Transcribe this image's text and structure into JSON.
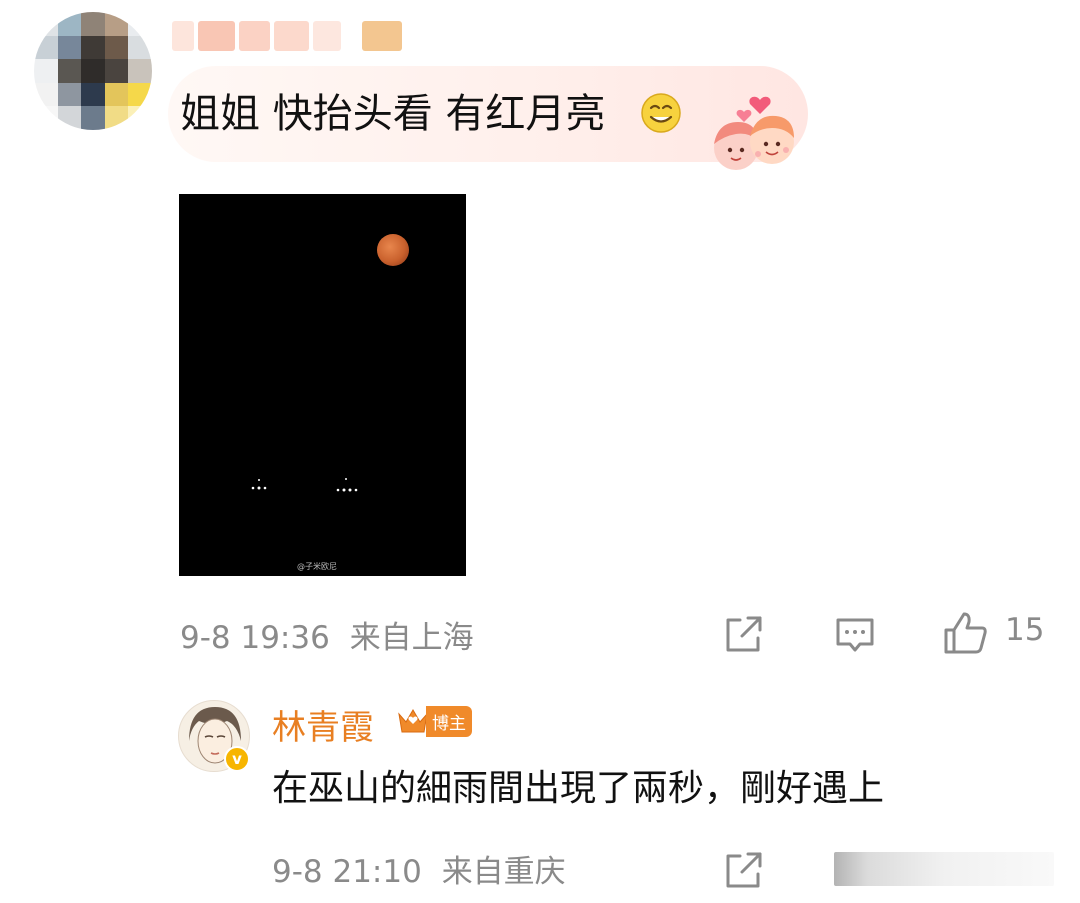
{
  "comment": {
    "text": "姐姐 快抬头看 有红月亮",
    "image": {
      "watermark": "@子米欧尼"
    },
    "meta": {
      "time": "9-8 19:36",
      "location": "来自上海",
      "like_count": "15"
    }
  },
  "reply": {
    "author": "林青霞",
    "author_tag": "博主",
    "text": "在巫山的細雨間出現了兩秒，剛好遇上",
    "meta": {
      "time": "9-8 21:10",
      "location": "来自重庆"
    }
  },
  "colors": {
    "author_name": "#e87f22",
    "meta_text": "#8a8a8a",
    "moon": "#c9612d"
  },
  "icons": [
    "share-icon",
    "comment-icon",
    "like-icon",
    "smile-emoji-icon",
    "heart-sticker-icon",
    "crown-icon",
    "verified-icon"
  ]
}
